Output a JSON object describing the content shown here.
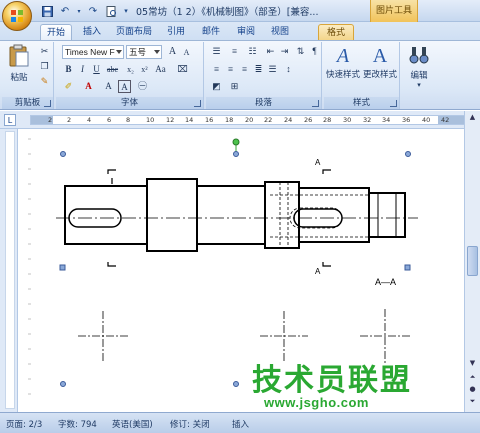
{
  "title_bar": {
    "title": "05常坊（1 2）《机械制图》（部圣）[兼容...",
    "context_tool": "图片工具"
  },
  "tabs": [
    {
      "label": "开始",
      "active": true
    },
    {
      "label": "插入"
    },
    {
      "label": "页面布局"
    },
    {
      "label": "引用"
    },
    {
      "label": "邮件"
    },
    {
      "label": "审阅"
    },
    {
      "label": "视图"
    },
    {
      "label": "格式",
      "contextual": true
    }
  ],
  "ribbon": {
    "clipboard": {
      "group_label": "剪贴板",
      "paste_label": "粘贴"
    },
    "font": {
      "group_label": "字体",
      "font_name": "Times New F",
      "font_size": "五号"
    },
    "paragraph": {
      "group_label": "段落"
    },
    "styles": {
      "group_label": "样式",
      "quick_styles_label": "快速样式",
      "change_styles_label": "更改样式"
    },
    "editing": {
      "label": "编辑"
    }
  },
  "ruler": {
    "numbers": [
      "2",
      "2",
      "4",
      "6",
      "8",
      "10",
      "12",
      "14",
      "16",
      "18",
      "20",
      "22",
      "24",
      "26",
      "28",
      "30",
      "32",
      "34",
      "36",
      "40",
      "42"
    ]
  },
  "drawing": {
    "section_label_top": "A",
    "section_label_bottom": "A",
    "section_view_label": "A—A"
  },
  "status_bar": {
    "page": "页面: 2/3",
    "words": "字数: 794",
    "language": "英语(美国)",
    "revisions": "修订: 关闭",
    "insert_mode": "插入"
  },
  "watermark": {
    "title": "技术员联盟",
    "url": "www.jsgho.com"
  }
}
